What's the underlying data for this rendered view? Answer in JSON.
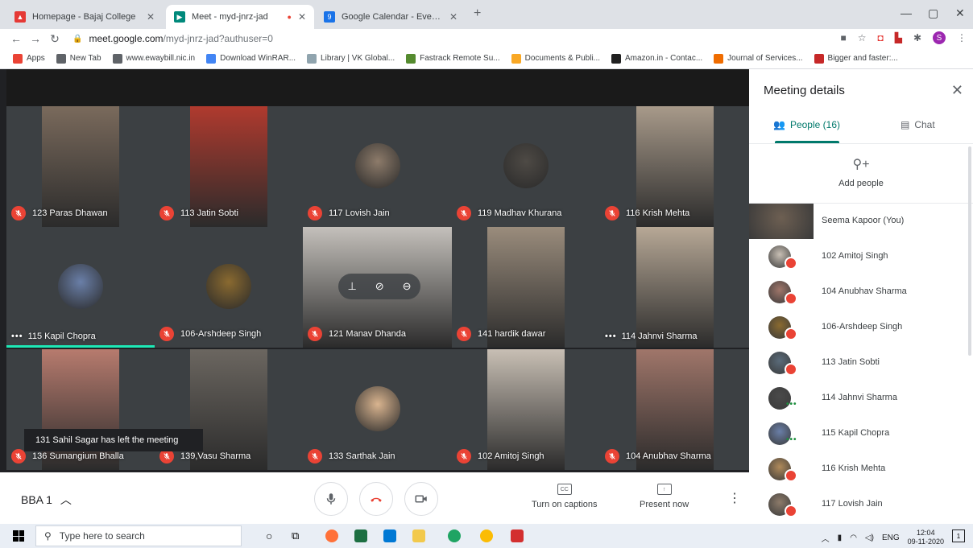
{
  "browser": {
    "tabs": [
      {
        "title": "Homepage - Bajaj College",
        "fav_color": "#e53935",
        "active": false
      },
      {
        "title": "Meet - myd-jnrz-jad",
        "fav_color": "#00897b",
        "active": true
      },
      {
        "title": "Google Calendar - Event details",
        "fav_color": "#1a73e8",
        "active": false
      }
    ],
    "url_host": "meet.google.com",
    "url_path": "/myd-jnrz-jad?authuser=0",
    "profile_initial": "S",
    "bookmarks": [
      {
        "label": "Apps",
        "color": "#ea4335"
      },
      {
        "label": "New Tab",
        "color": "#5f6368"
      },
      {
        "label": "www.ewaybill.nic.in",
        "color": "#5f6368"
      },
      {
        "label": "Download WinRAR...",
        "color": "#4285f4"
      },
      {
        "label": "Library | VK Global...",
        "color": "#90a4ae"
      },
      {
        "label": "Fastrack Remote Su...",
        "color": "#558b2f"
      },
      {
        "label": "Documents & Publi...",
        "color": "#f9a825"
      },
      {
        "label": "Amazon.in - Contac...",
        "color": "#212121"
      },
      {
        "label": "Journal of Services...",
        "color": "#ef6c00"
      },
      {
        "label": "Bigger and faster:...",
        "color": "#c62828"
      }
    ]
  },
  "meet": {
    "tiles": [
      {
        "name": "123 Paras Dhawan",
        "muted": true,
        "kind": "video",
        "color": "#7a6a5c"
      },
      {
        "name": "113 Jatin Sobti",
        "muted": true,
        "kind": "video",
        "color": "#b03a2e"
      },
      {
        "name": "117 Lovish Jain",
        "muted": true,
        "kind": "avatar",
        "color": "#8d7b6a"
      },
      {
        "name": "119 Madhav Khurana",
        "muted": true,
        "kind": "avatar",
        "color": "#4e4a45"
      },
      {
        "name": "116 Krish Mehta",
        "muted": true,
        "kind": "video",
        "color": "#a89a8a"
      },
      {
        "name": "115 Kapil Chopra",
        "muted": false,
        "kind": "avatar",
        "color": "#6a7fa8"
      },
      {
        "name": "106-Arshdeep Singh",
        "muted": true,
        "kind": "avatar",
        "color": "#8a6a30"
      },
      {
        "name": "121 Manav Dhanda",
        "muted": true,
        "kind": "video",
        "color": "#c4c0bb"
      },
      {
        "name": "141 hardik dawar",
        "muted": true,
        "kind": "video",
        "color": "#9a8c7c"
      },
      {
        "name": "114 Jahnvi Sharma",
        "muted": false,
        "kind": "video",
        "color": "#b7a896"
      },
      {
        "name": "136 Sumangium Bhalla",
        "muted": true,
        "kind": "video",
        "color": "#b77b6e"
      },
      {
        "name": "139,Vasu Sharma",
        "muted": true,
        "kind": "video",
        "color": "#6b6660"
      },
      {
        "name": "133 Sarthak Jain",
        "muted": true,
        "kind": "avatar",
        "color": "#d9b48f"
      },
      {
        "name": "102 Amitoj Singh",
        "muted": true,
        "kind": "video",
        "color": "#c8bfb4"
      },
      {
        "name": "104 Anubhav Sharma",
        "muted": true,
        "kind": "video",
        "color": "#a0766a"
      }
    ],
    "toast": "131 Sahil Sagar has left the meeting",
    "meeting_name": "BBA 1",
    "captions_label": "Turn on captions",
    "captions_icon": "CC",
    "present_label": "Present now"
  },
  "panel": {
    "title": "Meeting details",
    "people_tab": "People (16)",
    "chat_tab": "Chat",
    "add_people": "Add people",
    "people": [
      {
        "name": "Seema Kapoor (You)",
        "color": "#6d5f52",
        "status": "you"
      },
      {
        "name": "102 Amitoj Singh",
        "color": "#c8bfb4",
        "status": "muted"
      },
      {
        "name": "104 Anubhav Sharma",
        "color": "#a0766a",
        "status": "muted"
      },
      {
        "name": "106-Arshdeep Singh",
        "color": "#8a6a30",
        "status": "muted"
      },
      {
        "name": "113 Jatin Sobti",
        "color": "#5a6b7a",
        "status": "muted"
      },
      {
        "name": "114 Jahnvi Sharma",
        "color": "#4a4a4a",
        "status": "active"
      },
      {
        "name": "115 Kapil Chopra",
        "color": "#6a7fa8",
        "status": "active"
      },
      {
        "name": "116 Krish Mehta",
        "color": "#b08a5a",
        "status": "muted"
      },
      {
        "name": "117 Lovish Jain",
        "color": "#8d7b6a",
        "status": "muted"
      }
    ]
  },
  "taskbar": {
    "search_placeholder": "Type here to search",
    "lang": "ENG",
    "time": "12:04",
    "date": "09-11-2020",
    "notifications": "1"
  }
}
